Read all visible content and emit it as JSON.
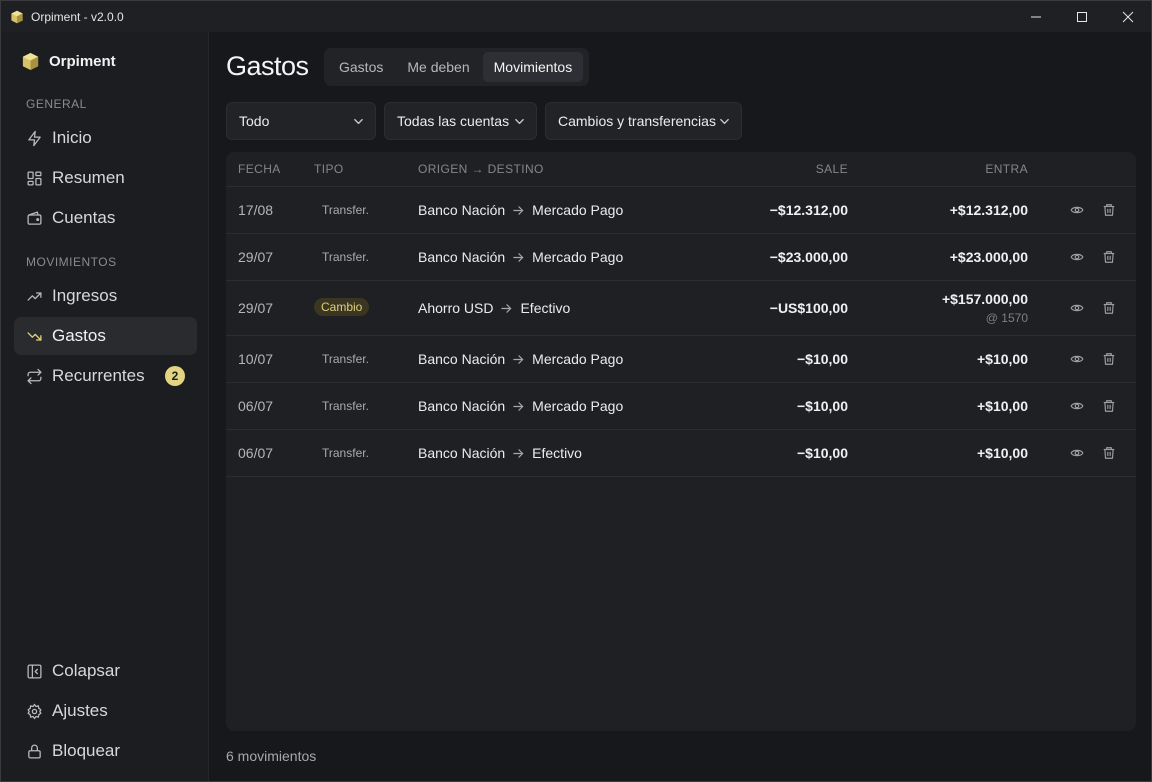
{
  "window": {
    "title": "Orpiment - v2.0.0"
  },
  "sidebar": {
    "brand": "Orpiment",
    "sections": {
      "general": "GENERAL",
      "movimientos": "MOVIMIENTOS"
    },
    "items": [
      {
        "label": "Inicio",
        "icon": "zap-icon"
      },
      {
        "label": "Resumen",
        "icon": "dashboard-icon"
      },
      {
        "label": "Cuentas",
        "icon": "wallet-icon"
      },
      {
        "label": "Ingresos",
        "icon": "trending-up-icon"
      },
      {
        "label": "Gastos",
        "icon": "trending-down-icon",
        "active": true
      },
      {
        "label": "Recurrentes",
        "icon": "repeat-icon",
        "badge": "2"
      }
    ],
    "bottom": [
      {
        "label": "Colapsar",
        "icon": "collapse-icon"
      },
      {
        "label": "Ajustes",
        "icon": "gear-icon"
      },
      {
        "label": "Bloquear",
        "icon": "lock-icon"
      }
    ]
  },
  "main": {
    "title": "Gastos",
    "tabs": [
      {
        "label": "Gastos"
      },
      {
        "label": "Me deben"
      },
      {
        "label": "Movimientos",
        "active": true
      }
    ],
    "filters": {
      "range": "Todo",
      "accounts": "Todas las cuentas",
      "kind": "Cambios y transferencias"
    },
    "table": {
      "headers": {
        "fecha": "FECHA",
        "tipo": "TIPO",
        "route": "ORIGEN → DESTINO",
        "sale": "SALE",
        "entra": "ENTRA"
      },
      "rows": [
        {
          "fecha": "17/08",
          "tipo": "Transfer.",
          "origen": "Banco Nación",
          "destino": "Mercado Pago",
          "sale": "−$12.312,00",
          "entra": "+$12.312,00"
        },
        {
          "fecha": "29/07",
          "tipo": "Transfer.",
          "origen": "Banco Nación",
          "destino": "Mercado Pago",
          "sale": "−$23.000,00",
          "entra": "+$23.000,00"
        },
        {
          "fecha": "29/07",
          "tipo": "Cambio",
          "origen": "Ahorro USD",
          "destino": "Efectivo",
          "sale": "−US$100,00",
          "entra": "+$157.000,00",
          "rate": "@ 1570"
        },
        {
          "fecha": "10/07",
          "tipo": "Transfer.",
          "origen": "Banco Nación",
          "destino": "Mercado Pago",
          "sale": "−$10,00",
          "entra": "+$10,00"
        },
        {
          "fecha": "06/07",
          "tipo": "Transfer.",
          "origen": "Banco Nación",
          "destino": "Mercado Pago",
          "sale": "−$10,00",
          "entra": "+$10,00"
        },
        {
          "fecha": "06/07",
          "tipo": "Transfer.",
          "origen": "Banco Nación",
          "destino": "Efectivo",
          "sale": "−$10,00",
          "entra": "+$10,00"
        }
      ]
    },
    "footer": "6 movimientos"
  },
  "colors": {
    "accent": "#e3d481",
    "background": "#17181b",
    "card": "#1f2023"
  }
}
